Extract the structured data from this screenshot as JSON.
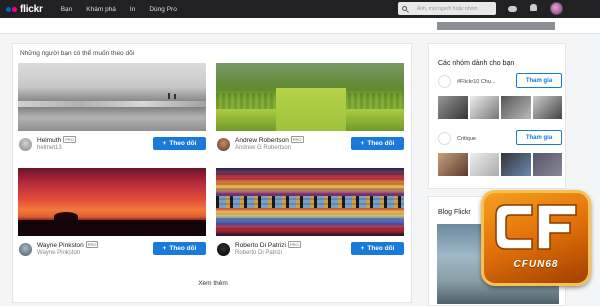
{
  "nav": {
    "logo_text": "flickr",
    "links": [
      "Bạn",
      "Khám phá",
      "In",
      "Dùng Pro"
    ],
    "search_placeholder": "Ảnh, mọi người hoặc nhóm"
  },
  "suggestions": {
    "title": "Những người bạn có thể muốn theo dõi",
    "pro_label": "PRO",
    "follow_label": "Theo dõi",
    "people": [
      {
        "name": "Helmuth",
        "pro": true,
        "username": "helmet13"
      },
      {
        "name": "Andrew Robertson",
        "pro": true,
        "username": "Andrew G Robertson"
      },
      {
        "name": "Wayne Pinkston",
        "pro": true,
        "username": "Wayne Pinkston"
      },
      {
        "name": "Roberto Di Patrizi",
        "pro": true,
        "username": "Roberto Di Patrizi"
      }
    ],
    "see_more": "Xem thêm"
  },
  "groups": {
    "title": "Các nhóm dành cho bạn",
    "join_label": "Tham gia",
    "items": [
      {
        "name": "#Flickr10 Chụ..."
      },
      {
        "name": "Critique"
      }
    ]
  },
  "blog": {
    "title": "Blog Flickr"
  },
  "watermark": {
    "brand": "CFUN68"
  },
  "colors": {
    "accent": "#1a7ad9",
    "nav_bg": "#212124",
    "badge": "#e07008"
  }
}
